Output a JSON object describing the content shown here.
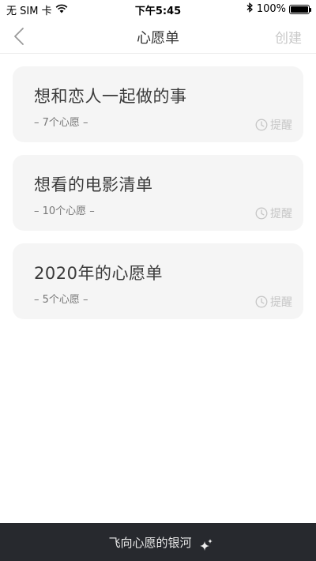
{
  "status_bar": {
    "carrier": "无 SIM 卡",
    "time": "下午5:45",
    "battery": "100%",
    "battery_level": 1.0
  },
  "nav": {
    "title": "心愿单",
    "create_label": "创建",
    "back_icon": "chevron-left-icon"
  },
  "cards": [
    {
      "title": "想和恋人一起做的事",
      "count": "– 7个心愿 –",
      "remind_label": "提醒"
    },
    {
      "title": "想看的电影清单",
      "count": "– 10个心愿 –",
      "remind_label": "提醒"
    },
    {
      "title": "2020年的心愿单",
      "count": "– 5个心愿 –",
      "remind_label": "提醒"
    }
  ],
  "bottom_bar": {
    "label": "飞向心愿的银河",
    "icon": "sparkle-icon"
  },
  "colors": {
    "card_bg": "#f5f5f5",
    "bottom_bar_bg": "#27292e",
    "muted": "#c6c6c6"
  }
}
